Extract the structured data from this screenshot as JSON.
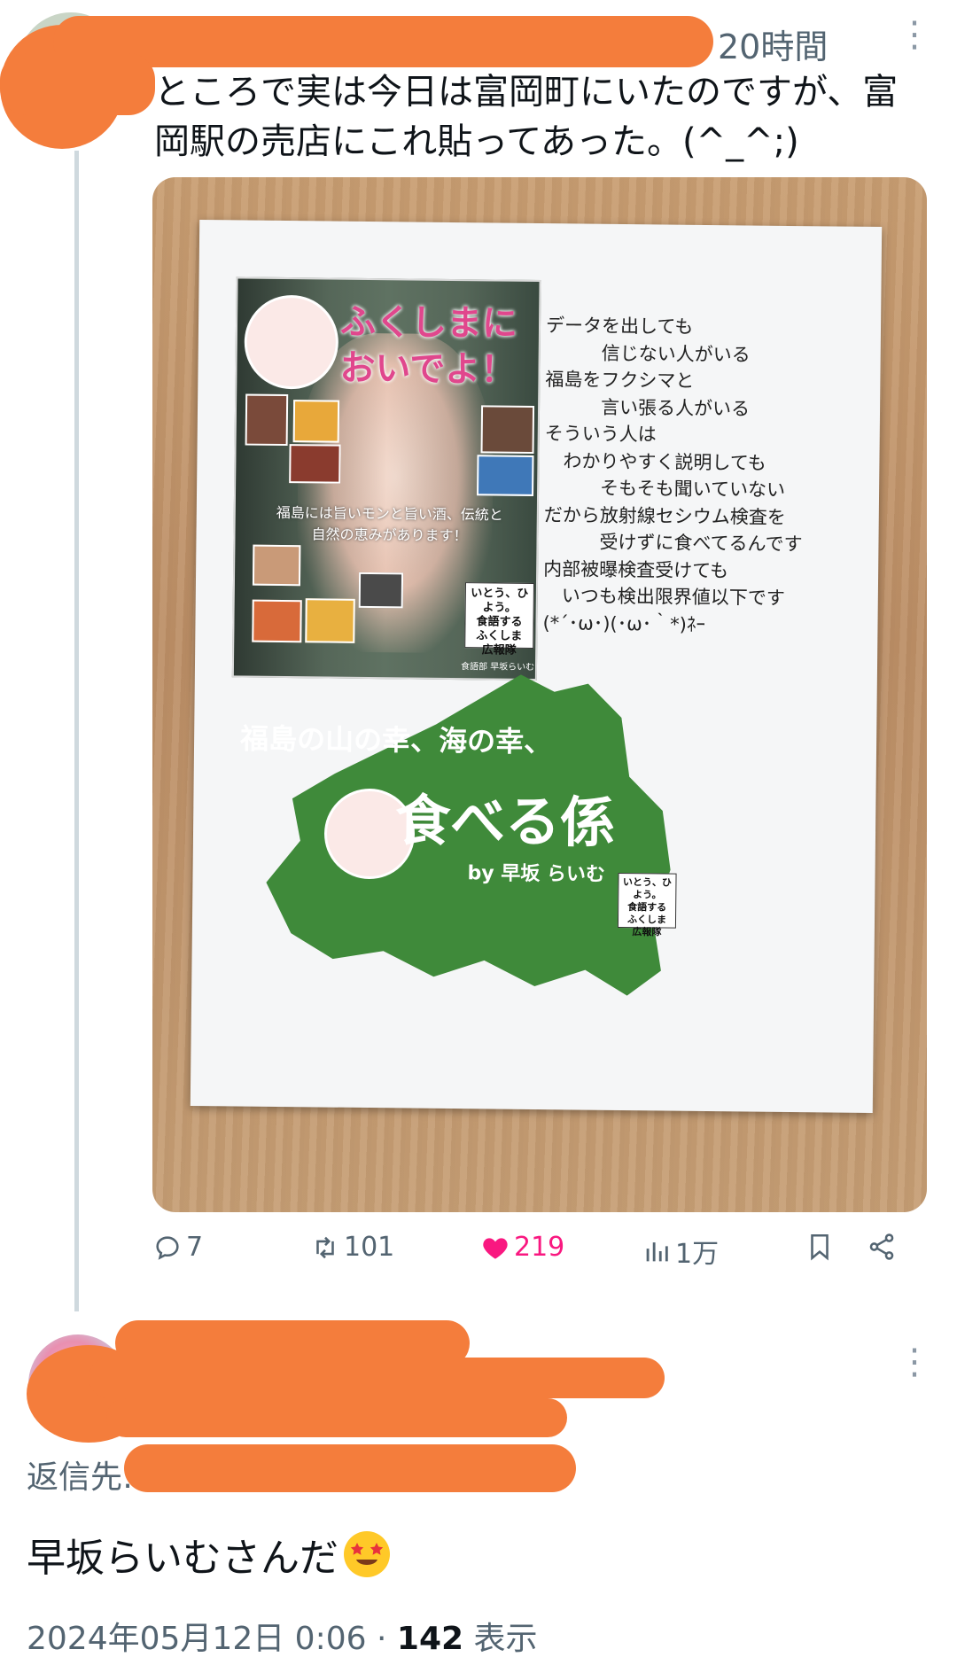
{
  "tweet": {
    "time_ago": "20時間",
    "text": "ところで実は今日は富岡町にいたのですが、富岡駅の売店にこれ貼ってあった。(^_^;)",
    "photo": {
      "flyer_title_line1": "ふくしまに",
      "flyer_title_line2": "おいでよ！",
      "flyer_sub": "福島には旨いモンと旨い酒、伝統と自然の恵みがあります！",
      "flyer_badge": "いとう、ひよう。\n食語する\nふくしま\n広報隊",
      "flyer_caption": "食語部 早坂らいむ",
      "poem": "データを出しても\n　　　信じない人がいる\n福島をフクシマと\n　　　言い張る人がいる\nそういう人は\n　わかりやすく説明しても\n　　　そもそも聞いていない\nだから放射線セシウム検査を\n　　　受けずに食べてるんです\n内部被曝検査受けても\n　いつも検出限界値以下です\n(*´･ω･)(･ω･｀*)ﾈｰ",
      "shape_line1": "福島の山の幸、海の幸、",
      "shape_line2": "食べる係",
      "shape_line3": "by 早坂 らいむ",
      "shape_badge": "いとう、ひよう。\n食語する\nふくしま\n広報隊"
    },
    "actions": {
      "replies": "7",
      "retweets": "101",
      "likes": "219",
      "views": "1万"
    }
  },
  "reply": {
    "reply_to_label": "返信先:",
    "text": "早坂らいむさんだ",
    "date": "2024年05月12日 0:06",
    "separator": "·",
    "view_count": "142",
    "view_label": "表示"
  },
  "colors": {
    "like_pink": "#f91880",
    "secondary_text": "#536471",
    "redaction": "#f47d3c",
    "map_green": "#3f8a3a"
  }
}
